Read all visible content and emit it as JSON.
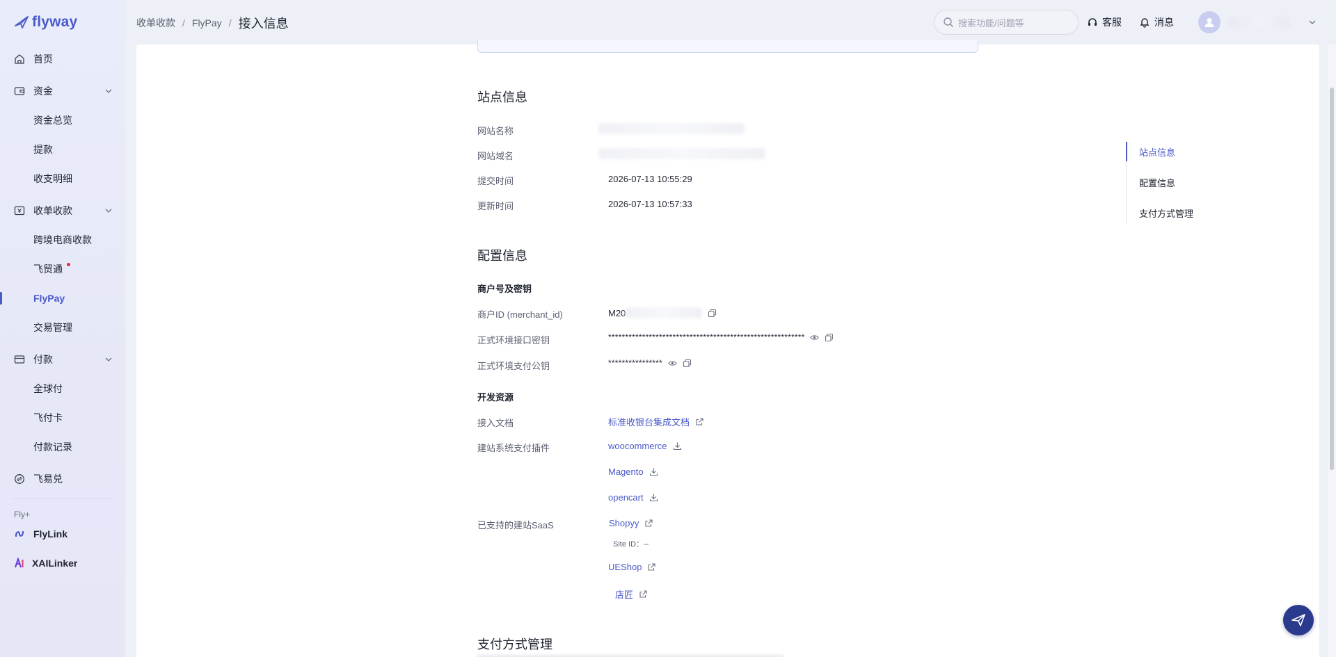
{
  "brand": {
    "name": "flyway",
    "accent": "#4a59c9"
  },
  "sidebar": {
    "items": [
      {
        "label": "首页",
        "icon": "home-icon"
      },
      {
        "label": "资金",
        "icon": "wallet-icon"
      },
      {
        "label": "资金总览"
      },
      {
        "label": "提款"
      },
      {
        "label": "收支明细"
      },
      {
        "label": "收单收款",
        "icon": "receipt-icon"
      },
      {
        "label": "跨境电商收款"
      },
      {
        "label": "飞贸通"
      },
      {
        "label": "FlyPay"
      },
      {
        "label": "交易管理"
      },
      {
        "label": "付款",
        "icon": "card-icon"
      },
      {
        "label": "全球付"
      },
      {
        "label": "飞付卡"
      },
      {
        "label": "付款记录"
      },
      {
        "label": "飞易兑",
        "icon": "exchange-icon"
      }
    ],
    "group_label": "Fly+",
    "extra": [
      {
        "label": "FlyLink",
        "icon": "flylink-icon"
      },
      {
        "label": "XAILinker",
        "icon": "xailinker-icon"
      }
    ]
  },
  "header": {
    "breadcrumb": [
      "收单收款",
      "FlyPay",
      "接入信息"
    ],
    "search_placeholder": "搜索功能/问题等",
    "support_label": "客服",
    "messages_label": "消息"
  },
  "site_info": {
    "title": "站点信息",
    "rows": [
      {
        "label": "网站名称",
        "value": ""
      },
      {
        "label": "网站域名",
        "value": ""
      },
      {
        "label": "提交时间",
        "value": "2026-07-13 10:55:29"
      },
      {
        "label": "更新时间",
        "value": "2026-07-13 10:57:33"
      }
    ]
  },
  "config": {
    "title": "配置信息",
    "keys_title": "商户号及密钥",
    "merchant_id_label": "商户ID (merchant_id)",
    "merchant_id_value": "M20",
    "prod_key_label": "正式环境接口密钥",
    "prod_key_value": "**********************************************************",
    "prod_pubkey_label": "正式环境支付公钥",
    "prod_pubkey_value": "****************",
    "dev_title": "开发资源",
    "doc_label": "接入文档",
    "doc_link": "标准收银台集成文档",
    "plugin_label": "建站系统支付插件",
    "plugins": [
      "woocommerce",
      "Magento",
      "opencart"
    ],
    "saas_label": "已支持的建站SaaS",
    "saas": [
      "Shopyy",
      "UEShop",
      "店匠"
    ],
    "site_id_text": "Site ID：--"
  },
  "payment": {
    "title": "支付方式管理"
  },
  "anchor": {
    "items": [
      "站点信息",
      "配置信息",
      "支付方式管理"
    ]
  }
}
